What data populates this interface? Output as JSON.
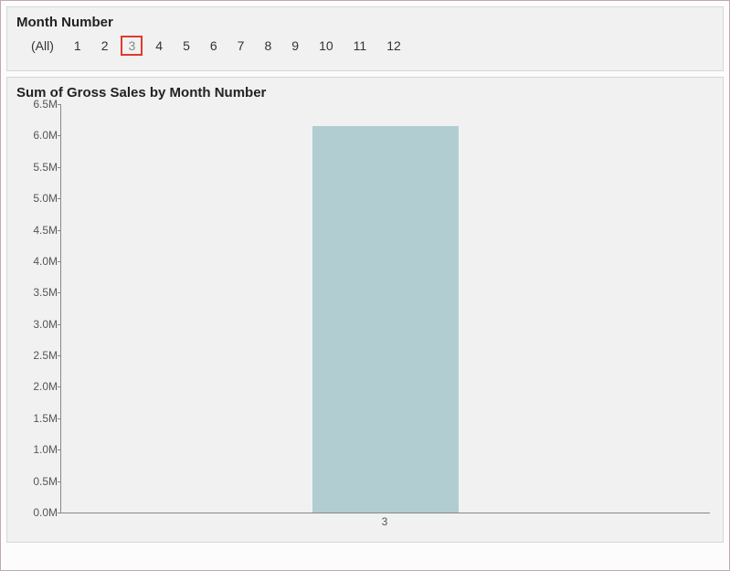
{
  "filter": {
    "title": "Month Number",
    "all_label": "(All)",
    "items": [
      "1",
      "2",
      "3",
      "4",
      "5",
      "6",
      "7",
      "8",
      "9",
      "10",
      "11",
      "12"
    ],
    "selected": "3"
  },
  "chart_data": {
    "type": "bar",
    "title": "Sum of Gross Sales by Month Number",
    "categories": [
      "3"
    ],
    "values": [
      6150000
    ],
    "xlabel": "",
    "ylabel": "",
    "ylim": [
      0,
      6500000
    ],
    "y_ticks": [
      0,
      500000,
      1000000,
      1500000,
      2000000,
      2500000,
      3000000,
      3500000,
      4000000,
      4500000,
      5000000,
      5500000,
      6000000,
      6500000
    ],
    "y_tick_labels": [
      "0.0M",
      "0.5M",
      "1.0M",
      "1.5M",
      "2.0M",
      "2.5M",
      "3.0M",
      "3.5M",
      "4.0M",
      "4.5M",
      "5.0M",
      "5.5M",
      "6.0M",
      "6.5M"
    ],
    "bar_color": "#b1cdd1"
  }
}
